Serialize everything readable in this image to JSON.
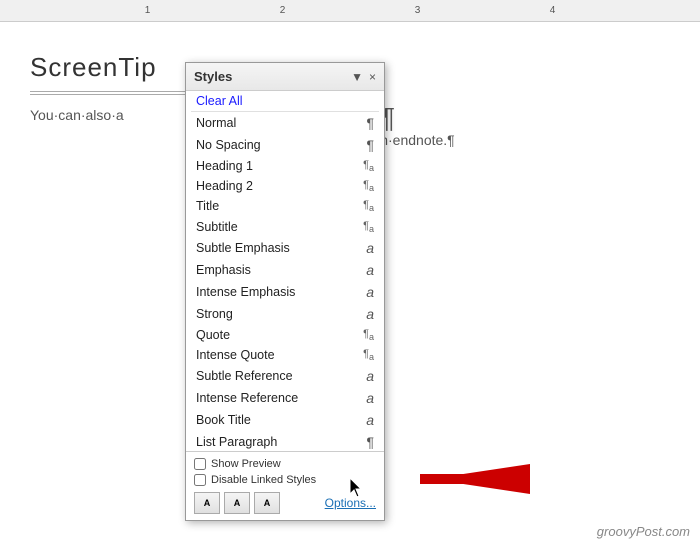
{
  "ruler": {
    "marks": [
      "1",
      "2",
      "3",
      "4"
    ]
  },
  "document": {
    "screentip": "ScreenTip",
    "body_text": "You·can·also·a",
    "right_para_mark": "¶",
    "right_text": "g·an·endnote.¶"
  },
  "styles_panel": {
    "title": "Styles",
    "collapse_icon": "▼",
    "close_icon": "×",
    "items": [
      {
        "label": "Clear All",
        "symbol": "",
        "type": "clear"
      },
      {
        "label": "Normal",
        "symbol": "¶",
        "type": "para"
      },
      {
        "label": "No Spacing",
        "symbol": "¶",
        "type": "para"
      },
      {
        "label": "Heading 1",
        "symbol": "¶a",
        "type": "heading"
      },
      {
        "label": "Heading 2",
        "symbol": "¶a",
        "type": "heading"
      },
      {
        "label": "Title",
        "symbol": "¶a",
        "type": "heading"
      },
      {
        "label": "Subtitle",
        "symbol": "¶a",
        "type": "heading"
      },
      {
        "label": "Subtle Emphasis",
        "symbol": "a",
        "type": "emphasis"
      },
      {
        "label": "Emphasis",
        "symbol": "a",
        "type": "emphasis"
      },
      {
        "label": "Intense Emphasis",
        "symbol": "a",
        "type": "emphasis"
      },
      {
        "label": "Strong",
        "symbol": "a",
        "type": "emphasis"
      },
      {
        "label": "Quote",
        "symbol": "¶a",
        "type": "heading"
      },
      {
        "label": "Intense Quote",
        "symbol": "¶a",
        "type": "heading"
      },
      {
        "label": "Subtle Reference",
        "symbol": "a",
        "type": "emphasis"
      },
      {
        "label": "Intense Reference",
        "symbol": "a",
        "type": "emphasis"
      },
      {
        "label": "Book Title",
        "symbol": "a",
        "type": "emphasis"
      },
      {
        "label": "List Paragraph",
        "symbol": "¶",
        "type": "para"
      }
    ],
    "footer": {
      "show_preview": "Show Preview",
      "disable_linked": "Disable Linked Styles",
      "options_link": "Options..."
    },
    "buttons": [
      {
        "icon": "A↑",
        "name": "new-style-button"
      },
      {
        "icon": "A↗",
        "name": "style-inspector-button"
      },
      {
        "icon": "Aa",
        "name": "manage-styles-button"
      }
    ]
  },
  "watermark": {
    "text": "groovyPost.com"
  }
}
